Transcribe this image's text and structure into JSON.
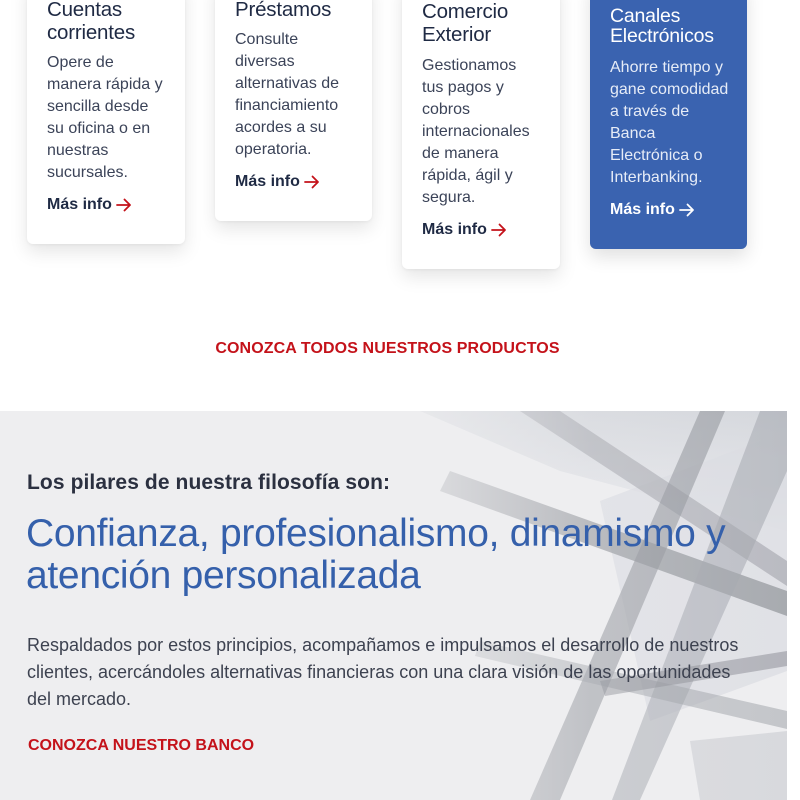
{
  "cards": [
    {
      "title": "Cuentas corrientes",
      "text": "Opere de manera rápida y sencilla desde su oficina o en nuestras sucursales.",
      "link": "Más info"
    },
    {
      "title": "Préstamos",
      "text": "Consulte diversas alternativas de financiamiento acordes a su operatoria.",
      "link": "Más info"
    },
    {
      "title": "Comercio Exterior",
      "text": "Gestionamos tus pagos y cobros internacionales de manera rápida, ágil y segura.",
      "link": "Más info"
    },
    {
      "title": "Canales Electrónicos",
      "text": "Ahorre tiempo y gane comodidad a través de Banca Electrónica o Interbanking.",
      "link": "Más info"
    }
  ],
  "products_cta": "CONOZCA TODOS NUESTROS PRODUCTOS",
  "philosophy": {
    "subtitle": "Los pilares de nuestra filosofía son:",
    "headline": "Confianza, profesionalismo, dinamismo y atención personalizada",
    "body": "Respaldados por estos principios, acompañamos e impulsamos el desarrollo de nuestros clientes, acercándoles alternativas financieras con una clara visión de las oportunidades del mercado.",
    "cta": "CONOZCA NUESTRO BANCO"
  },
  "icons": {
    "card_link": "arrow-right-icon"
  },
  "colors": {
    "brand_blue": "#3560ab",
    "card_blue": "#3a63b0",
    "accent_red": "#c4121a",
    "dark_text": "#1f2a44"
  }
}
